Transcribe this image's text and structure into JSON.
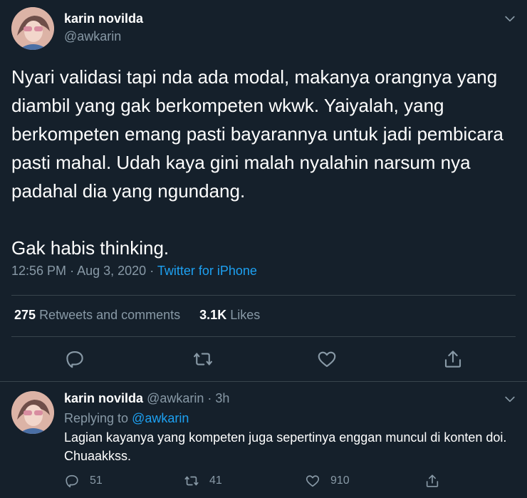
{
  "tweet": {
    "author_name": "karin novilda",
    "author_handle": "@awkarin",
    "text": "Nyari validasi tapi nda ada modal, makanya orangnya yang diambil yang gak berkompeten wkwk. Yaiyalah, yang berkompeten emang pasti bayarannya untuk jadi pembicara pasti mahal. Udah kaya gini malah nyalahin narsum nya padahal dia yang ngundang.\n\nGak habis thinking.",
    "time": "12:56 PM",
    "separator": "·",
    "date": "Aug 3, 2020",
    "source": "Twitter for iPhone",
    "stats": {
      "retweets_count": "275",
      "retweets_label": "Retweets and comments",
      "likes_count": "3.1K",
      "likes_label": "Likes"
    }
  },
  "reply": {
    "author_name": "karin novilda",
    "author_handle": "@awkarin",
    "separator": "·",
    "age": "3h",
    "replying_prefix": "Replying to",
    "replying_to": "@awkarin",
    "text": "Lagian kayanya yang kompeten juga sepertinya enggan muncul di konten doi. Chuaakkss.",
    "counts": {
      "replies": "51",
      "retweets": "41",
      "likes": "910"
    }
  },
  "icons": {
    "more": "chevron-down-icon",
    "reply": "reply-icon",
    "retweet": "retweet-icon",
    "like": "heart-icon",
    "share": "share-icon"
  },
  "colors": {
    "background": "#15202b",
    "accent": "#1da1f2",
    "secondary_text": "#8899a6",
    "divider": "#38444d"
  }
}
